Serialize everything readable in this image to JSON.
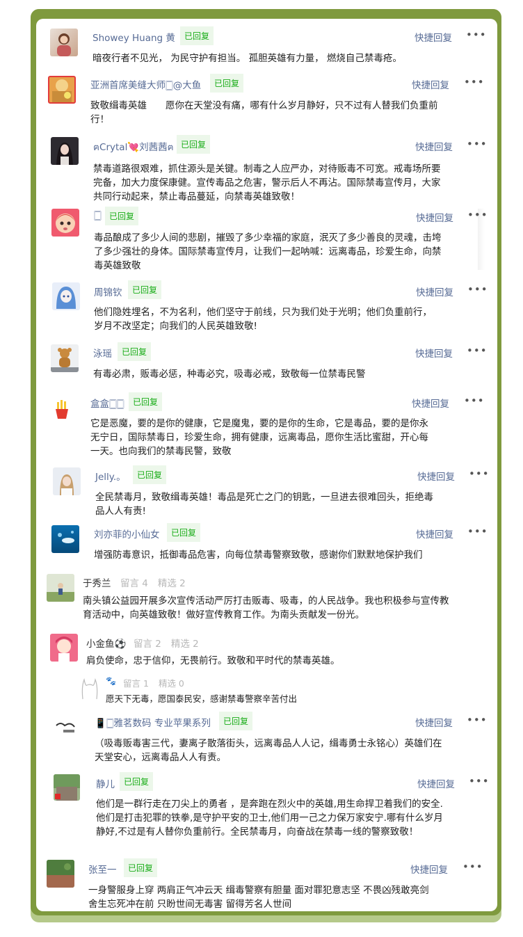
{
  "badge_label": "已回复",
  "quick_reply_label": "快捷回复",
  "more_label": "•••",
  "comments": [
    {
      "name": "Showey Huang 黄",
      "text": "暗夜行者不见光， 为民守护有担当。 孤胆英雄有力量， 燃烧自己禁毒疮。"
    },
    {
      "name": "亚洲首席美缝大师🀆@大鱼",
      "text": "致敬缉毒英雄　　愿你在天堂没有痛，哪有什么岁月静好，只不过有人替我们负重前行！"
    },
    {
      "name": "ฅCrytal💘刘茜茜ฅ",
      "text": "禁毒道路很艰难，抓住源头是关键。制毒之人应严办，对待贩毒不可宽。戒毒场所要完备，加大力度保康健。宣传毒品之危害，警示后人不再沾。国际禁毒宣传月，大家共同行动起来，禁止毒品蔓延，向禁毒英雄致敬！"
    },
    {
      "name": "🀆",
      "text": "毒品酿成了多少人间的悲剧，摧毁了多少幸福的家庭，泯灭了多少善良的灵魂，击垮了多少强壮的身体。国际禁毒宣传月，让我们一起呐喊：远离毒品，珍爱生命，向禁毒英雄致敬"
    },
    {
      "name": "周锦钦",
      "text": "他们隐姓埋名，不为名利，他们坚守于前线，只为我们处于光明；他们负重前行，岁月不改坚定；向我们的人民英雄致敬!"
    },
    {
      "name": "泳瑶",
      "text": "有毒必肃，贩毒必惩，种毒必究，吸毒必戒，致敬每一位禁毒民警"
    },
    {
      "name": "盒盒🀆🀆",
      "text": "它是恶魔，要的是你的健康，它是魔鬼，要的是你的生命，它是毒品，要的是你永无宁日，国际禁毒日，珍爱生命，拥有健康，远离毒品，愿你生活比蜜甜，开心每一天。也向我们的禁毒民警，致敬"
    },
    {
      "name": "Jelly.。",
      "text": "全民禁毒月，致敬缉毒英雄！毒品是死亡之门的钥匙，一旦进去很难回头，拒绝毒品人人有责!"
    },
    {
      "name": "刘亦菲的小仙女",
      "text": "增强防毒意识，抵御毒品危害，向每位禁毒警察致敬，感谢你们默默地保护我们"
    }
  ],
  "user_posts": [
    {
      "name": "于秀兰",
      "stat1": "留言 4",
      "stat2": "精选 2",
      "text": "南头镇公益园开展多次宣传活动严厉打击贩毒、吸毒，的人民战争。我也积极参与宣传教育活动中，向英雄致敬！做好宣传教育工作。为南头贡献发一份光。"
    },
    {
      "name": "小金鱼⚽",
      "stat1": "留言 2",
      "stat2": "精选 2",
      "text": "肩负使命，忠于信仰，无畏前行。致敬和平时代的禁毒英雄。"
    },
    {
      "name": "🐾",
      "stat1": "留言 1",
      "stat2": "精选 0",
      "text": "愿天下无毒，愿国泰民安，感谢禁毒警察辛苦付出"
    }
  ],
  "comments2": [
    {
      "name": "📱🀆雅茗数码 专业苹果系列",
      "text": "（吸毒贩毒害三代，妻离子散落街头，远离毒品人人记，缉毒勇士永铭心）英雄们在天堂安心，远离毒品人人有责。"
    },
    {
      "name": "静儿",
      "text": "他们是一群行走在刀尖上的勇者 ，是奔跑在烈火中的英雄,用生命捍卫着我们的安全.他们是打击犯罪的铁拳,是守护平安的卫士,他们用一己之力保万家安宁.哪有什么岁月静好,不过是有人替你负重前行。全民禁毒月，向奋战在禁毒一线的警察致敬！"
    },
    {
      "name": "张至一",
      "text": "一身警服身上穿 两肩正气冲云天 缉毒警察有胆量 面对罪犯意志坚 不畏凶残敢亮剑 舍生忘死冲在前 只盼世间无毒害 留得芳名人世间"
    }
  ]
}
